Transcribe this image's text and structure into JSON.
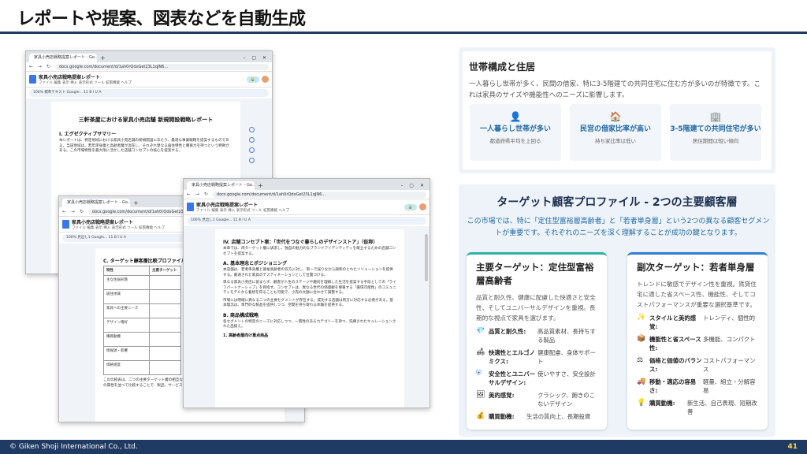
{
  "slide": {
    "title": "レポートや提案、図表などを自動生成",
    "footer": "© Giken Shoji International Co., Ltd.",
    "page_number": "41"
  },
  "windows": [
    {
      "tab": "家具小売店戦略提案レポート - Go...",
      "url": "docs.google.com/document/d/1ah0rQdxGet23L1qJN6...",
      "doc_name": "家具小売店戦略提案レポート",
      "menu": "ファイル  編集  表示  挿入  表示形式  ツール  拡張機能  ヘルプ",
      "toolbar": "100%   標準テキスト   Google...   11   B I U A"
    },
    {
      "tab": "家具小売店戦略提案レポート - Go...",
      "url": "docs.google.com/document/d/1ah0rQdxGet23L1qJN6...",
      "doc_name": "家具小売店戦略提案レポート",
      "menu": "ファイル  編集  表示  挿入  表示形式  ツール  拡張機能  ヘルプ",
      "toolbar": "100%   見出し1   Google...   11   B I U A"
    },
    {
      "tab": "家具小売店戦略提案レポート - Go...",
      "url": "docs.google.com/document/d/1ah0rQdxGet23L1qJN6...",
      "doc_name": "家具小売店戦略提案レポート",
      "menu": "ファイル  編集  表示  挿入  表示形式  ツール  拡張機能  ヘルプ",
      "toolbar": "100%   見出し1   Google...   11   B I U A"
    }
  ],
  "doc1": {
    "title": "三軒茶屋における家具小売店舗 新規開設戦略レポート",
    "h1": "I. エグゼクティブサマリー",
    "p1": "本レポートは、特定地域における家具小売店舗の新規開設にあたり、最適な事業戦略を提案するものである。当該地域は、若年単身層と高齢者層が混在し、それぞれ異なる居住特性と購買力を持つという特徴がある。この市場特性を最大限に活かした店舗コンセプトの核心を提案する。"
  },
  "doc2": {
    "h1": "C. ターゲット顧客層比較プロファイル",
    "headers": [
      "特性",
      "主要ターゲット"
    ],
    "rows": [
      "主な住居形態",
      "居住地域",
      "家具への主要ニーズ",
      "デザイン嗜好",
      "購買動機",
      "情報源・影響",
      "価格感度"
    ],
    "footer_text": "この比較表は、二つの主要ターゲット層の相互な特性とニーズの明確な違いを浮き彫りにする。それぞれの属性を並べて比較することで、製品、サービス、マーケティング"
  },
  "doc3": {
    "h1": "IV. 店舗コンセプト案：「世代をつなぐ暮らしのデザインストア」（仮称）",
    "p1": "本章では、両ターゲット層に訴求し、独自の魅力的なブランドアイデンティティを確立するための店舗コンセプトを提案する。",
    "h2": "A. 基本理念とポジショニング",
    "p2": "本店舗は、若者単身層と富裕高齢者の双方に対し、単一で誤りなから調和のとれたソリューションを提供する。最適された家具のデスティネーションとして位置づける。",
    "p3": "単なる家具小売店に留まらず、顧客が人生のステージや趣向を理解した生活を提案する手段としての「ライフパートナーシップ」を目指す。コンセプトは、異なる世代の価値観を尊重する「循環可能性」のコミュニティモデルから着想を得ることも可能で、小売の文脈に合わせて調整する。",
    "p4": "市場には明確に異なる二つの主要セグメントが存在する。成功する店舗は両方に対応する必要がある。基本理念は、専門的な製品を提供しつつ、空間を持ち寄れる体験を提供する。",
    "h3": "B. 商品構成戦略",
    "p5": "各セグメントの特定のニーズに対応しつつ、一貫性のあるカテゴリーを持つ、洗練されたキュレーションされた品揃え。",
    "item1": "1. 高齢者層向け重点商品"
  },
  "household": {
    "title": "世帯構成と住居",
    "desc": "一人暮らし世帯が多く、民間の借家、特に3-5階建ての共同住宅に住む方が多いのが特徴です。これは家具のサイズや機能性へのニーズに影響します。",
    "stats": [
      {
        "icon": "person-icon",
        "label": "一人暮らし世帯が多い",
        "sub": "都道府県平均を上回る"
      },
      {
        "icon": "house-icon",
        "label": "民営の借家比率が高い",
        "sub": "持ち家比率は低い"
      },
      {
        "icon": "building-icon",
        "label": "3-5階建ての共同住宅が多い",
        "sub": "居住期間は短い傾向"
      }
    ]
  },
  "target": {
    "title": "ターゲット顧客プロファイル - 2つの主要顧客層",
    "desc": "この市場では、特に「定住型富裕層高齢者」と「若者単身層」という2つの異なる顧客セグメントが重要です。それぞれのニーズを深く理解することが成功の鍵となります。",
    "primary": {
      "title": "主要ターゲット：定住型富裕層高齢者",
      "desc": "品質と耐久性、健康に配慮した快適さと安全性、そしてユニバーサルデザインを重視。長期的な視点で家具を選びます。",
      "attrs": [
        {
          "key": "品質と耐久性:",
          "val": "高品質素材、長持ちする製品"
        },
        {
          "key": "快適性とエルゴノミクス:",
          "val": "健康配慮、身体サポート"
        },
        {
          "key": "安全性とユニバーサルデザイン:",
          "val": "使いやすさ、安全設計"
        },
        {
          "key": "美的感覚:",
          "val": "クラシック、飽きのこないデザイン"
        },
        {
          "key": "購買動機:",
          "val": "生活の質向上、長期投資"
        }
      ]
    },
    "secondary": {
      "title": "副次ターゲット：若者単身層",
      "desc": "トレンドに敏感でデザイン性を重視。賃貸住宅に適した省スペース性、機能性、そしてコストパフォーマンスが重要な選択基準です。",
      "attrs": [
        {
          "key": "スタイルと美的感覚:",
          "val": "トレンディ、個性的"
        },
        {
          "key": "機能性と省スペース性:",
          "val": "多機能、コンパクト"
        },
        {
          "key": "価格と価値のバランス:",
          "val": "コストパフォーマンス"
        },
        {
          "key": "移動・適応の容易さ:",
          "val": "軽量、組立・分解容易"
        },
        {
          "key": "購買動機:",
          "val": "新生活、自己表現、短期改善"
        }
      ]
    }
  }
}
